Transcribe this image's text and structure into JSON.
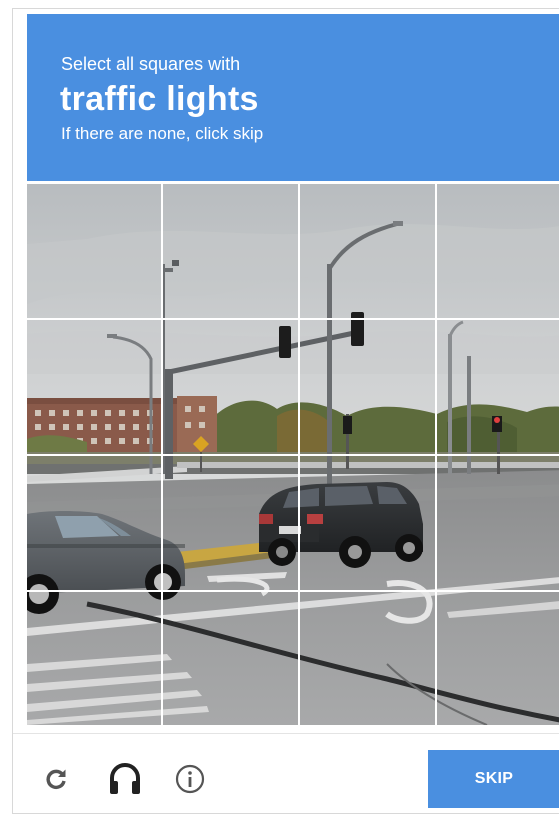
{
  "header": {
    "instruction": "Select all squares with",
    "target": "traffic lights",
    "hint": "If there are none, click skip"
  },
  "grid": {
    "rows": 4,
    "columns": 4
  },
  "footer": {
    "reload_icon": "reload-icon",
    "audio_icon": "headphones-icon",
    "info_icon": "info-icon",
    "skip_label": "SKIP"
  },
  "colors": {
    "accent": "#4a8fe0",
    "icon": "#555555"
  }
}
